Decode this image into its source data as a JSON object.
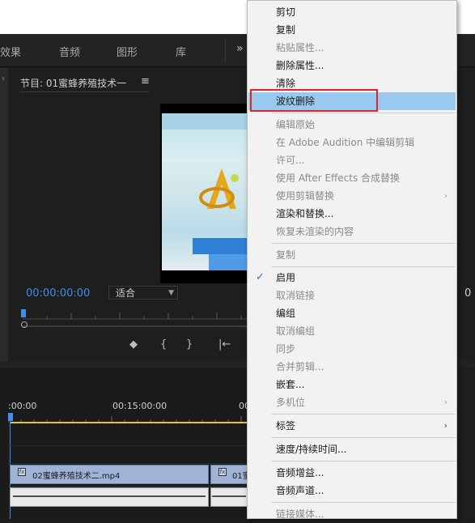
{
  "workspace": {
    "tabs": [
      "效果",
      "音频",
      "图形",
      "库"
    ],
    "more": "»"
  },
  "monitor": {
    "title": "节目: 01蜜蜂养殖技术一",
    "menu_icon": "hamburger-icon",
    "timecode": "00:00:00:00",
    "fit": "适合",
    "right_timecode": "0"
  },
  "timeline": {
    "times": [
      ":00:00",
      "00:15:00:00",
      "00"
    ],
    "clips": [
      {
        "label": "02蜜蜂养殖技术二.mp4"
      },
      {
        "label": "01蜜"
      }
    ]
  },
  "context_menu": {
    "items": [
      {
        "label": "剪切",
        "enabled": true
      },
      {
        "label": "复制",
        "enabled": true
      },
      {
        "label": "粘贴属性...",
        "enabled": false
      },
      {
        "label": "删除属性...",
        "enabled": true
      },
      {
        "label": "清除",
        "enabled": true
      },
      {
        "label": "波纹删除",
        "enabled": true,
        "highlighted": true
      },
      {
        "label": "编辑原始",
        "enabled": false
      },
      {
        "label": "在 Adobe Audition 中编辑剪辑",
        "enabled": false
      },
      {
        "label": "许可...",
        "enabled": false
      },
      {
        "label": "使用 After Effects 合成替换",
        "enabled": false
      },
      {
        "label": "使用剪辑替换",
        "enabled": false,
        "submenu": true
      },
      {
        "label": "渲染和替换...",
        "enabled": true
      },
      {
        "label": "恢复未渲染的内容",
        "enabled": false
      },
      {
        "label": "复制",
        "enabled": false
      },
      {
        "label": "启用",
        "enabled": true,
        "checked": true
      },
      {
        "label": "取消链接",
        "enabled": false
      },
      {
        "label": "编组",
        "enabled": true
      },
      {
        "label": "取消编组",
        "enabled": false
      },
      {
        "label": "同步",
        "enabled": false
      },
      {
        "label": "合并剪辑...",
        "enabled": false
      },
      {
        "label": "嵌套...",
        "enabled": true
      },
      {
        "label": "多机位",
        "enabled": false,
        "submenu": true
      },
      {
        "label": "标签",
        "enabled": true,
        "submenu": true
      },
      {
        "label": "速度/持续时间...",
        "enabled": true
      },
      {
        "label": "音频增益...",
        "enabled": true
      },
      {
        "label": "音频声道...",
        "enabled": true
      },
      {
        "label": "链接媒体...",
        "enabled": false
      }
    ],
    "highlight_color": "#99c9ef",
    "annotation_color": "#e0262b"
  }
}
